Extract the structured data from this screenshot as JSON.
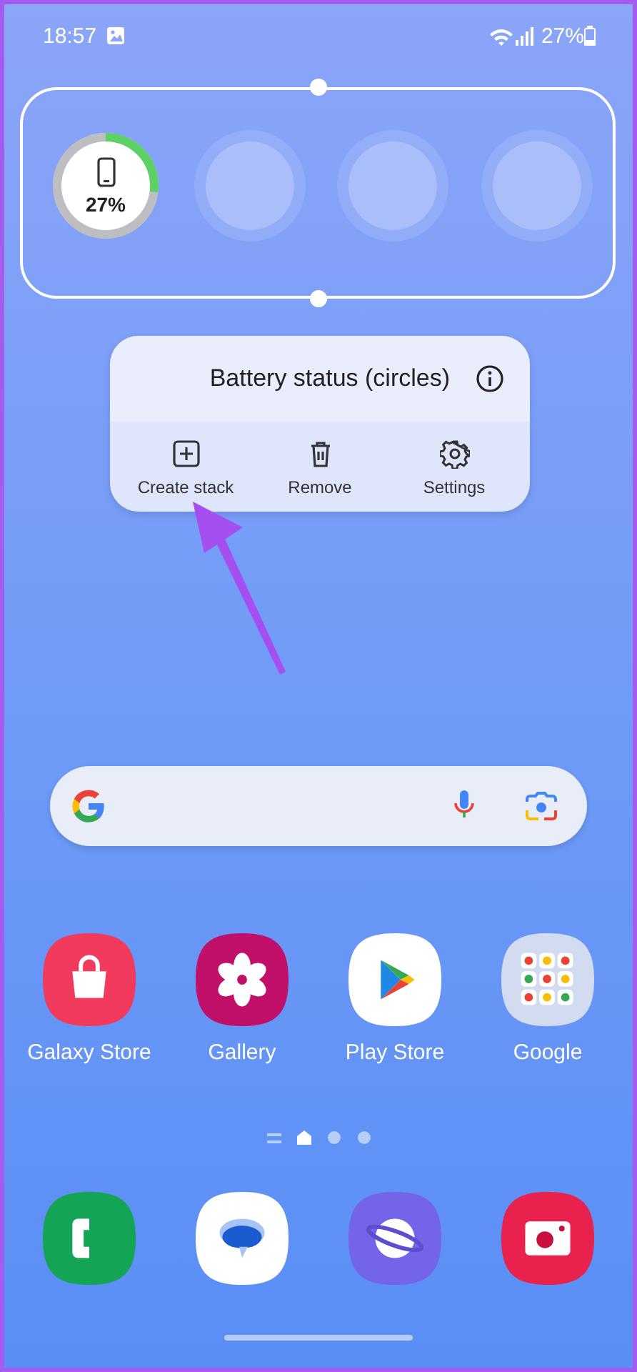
{
  "status_bar": {
    "time": "18:57",
    "battery": "27%"
  },
  "widget": {
    "slots": [
      {
        "kind": "battery",
        "level": 0.27,
        "reading": "27%"
      },
      {
        "kind": "empty"
      },
      {
        "kind": "empty"
      },
      {
        "kind": "empty"
      }
    ]
  },
  "popup": {
    "title": "Battery status (circles)",
    "actions": [
      {
        "kind": "create",
        "label": "Create stack"
      },
      {
        "kind": "remove",
        "label": "Remove"
      },
      {
        "kind": "settings",
        "label": "Settings"
      }
    ]
  },
  "apps": [
    {
      "kind": "store",
      "label": "Galaxy Store"
    },
    {
      "kind": "gallery",
      "label": "Gallery"
    },
    {
      "kind": "play",
      "label": "Play Store"
    },
    {
      "kind": "folder",
      "label": "Google"
    }
  ],
  "page_dots": [
    {
      "kind": "list",
      "selected": false
    },
    {
      "kind": "home",
      "selected": true
    },
    {
      "kind": "dot",
      "selected": false
    },
    {
      "kind": "dot",
      "selected": false
    }
  ],
  "dock": [
    {
      "kind": "phone"
    },
    {
      "kind": "messages"
    },
    {
      "kind": "internet"
    },
    {
      "kind": "camera"
    }
  ]
}
